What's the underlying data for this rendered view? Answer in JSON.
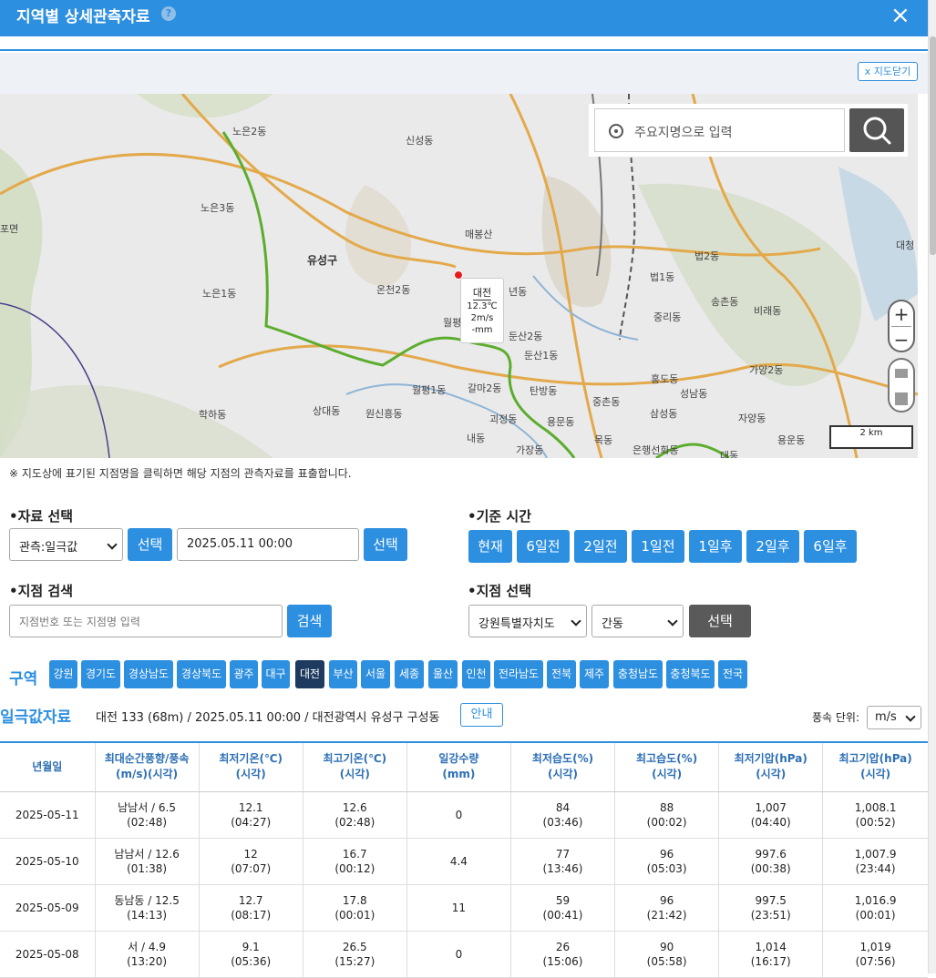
{
  "window": {
    "title": "지역별 상세관측자료",
    "help_icon": "?",
    "close_icon": "×"
  },
  "map": {
    "toggle_label": "x 지도닫기",
    "search_placeholder": "주요지명으로 입력",
    "labels": [
      "노은2동",
      "신성동",
      "노은3동",
      "유성구",
      "매봉산",
      "노은1동",
      "온천2동",
      "년동",
      "월평",
      "둔산2동",
      "둔산1동",
      "월평1동",
      "갈마2동",
      "탄방동",
      "상대동",
      "원신흥동",
      "괴정동",
      "용문동",
      "학하동",
      "내동",
      "가장동",
      "중촌동",
      "삼성동",
      "홍도동",
      "성남동",
      "법2동",
      "법1동",
      "송촌동",
      "비래동",
      "중리동",
      "가양2동",
      "자양동",
      "용운동",
      "목동",
      "은행선화동",
      "대동",
      "대청",
      "포면"
    ],
    "station": {
      "name": "대전",
      "temp": "12.3℃",
      "wind": "2m/s",
      "rain": "-mm"
    },
    "scale_label": "2 km",
    "zoom_in": "+",
    "zoom_out": "−"
  },
  "notice": "※ 지도상에 표기된 지점명을 클릭하면 해당 지점의 관측자료를 표출합니다.",
  "data_select": {
    "label": "•자료 선택",
    "type_value": "관측:일극값",
    "select_btn": "선택",
    "date_value": "2025.05.11 00:00",
    "select_btn2": "선택"
  },
  "base_time": {
    "label": "•기준 시간",
    "buttons": [
      "현재",
      "6일전",
      "2일전",
      "1일전",
      "1일후",
      "2일후",
      "6일후"
    ]
  },
  "station_search": {
    "label": "•지점 검색",
    "placeholder": "지점번호 또는 지점명 입력",
    "search_btn": "검색"
  },
  "station_select": {
    "label": "•지점 선택",
    "province": "강원특별자치도",
    "station": "간동",
    "select_btn": "선택"
  },
  "regions": {
    "label": "구역",
    "items": [
      "강원",
      "경기도",
      "경상남도",
      "경상북도",
      "광주",
      "대구",
      "대전",
      "부산",
      "서울",
      "세종",
      "울산",
      "인천",
      "전라남도",
      "전북",
      "제주",
      "충청남도",
      "충청북도",
      "전국"
    ],
    "active": "대전"
  },
  "result": {
    "title": "일극값자료",
    "info": "대전 133 (68m) / 2025.05.11 00:00 / 대전광역시 유성구 구성동",
    "guide_btn": "안내",
    "wind_unit_label": "풍속 단위:",
    "wind_unit_value": "m/s"
  },
  "table": {
    "headers": [
      [
        "년월일",
        ""
      ],
      [
        "최대순간풍향/풍속",
        "(m/s)(시각)"
      ],
      [
        "최저기온(℃)",
        "(시각)"
      ],
      [
        "최고기온(℃)",
        "(시각)"
      ],
      [
        "일강수량",
        "(mm)"
      ],
      [
        "최저습도(%)",
        "(시각)"
      ],
      [
        "최고습도(%)",
        "(시각)"
      ],
      [
        "최저기압(hPa)",
        "(시각)"
      ],
      [
        "최고기압(hPa)",
        "(시각)"
      ]
    ],
    "rows": [
      [
        [
          "2025-05-11",
          ""
        ],
        [
          "남남서 / 6.5",
          "(02:48)"
        ],
        [
          "12.1",
          "(04:27)"
        ],
        [
          "12.6",
          "(02:48)"
        ],
        [
          "0",
          ""
        ],
        [
          "84",
          "(03:46)"
        ],
        [
          "88",
          "(00:02)"
        ],
        [
          "1,007",
          "(04:40)"
        ],
        [
          "1,008.1",
          "(00:52)"
        ]
      ],
      [
        [
          "2025-05-10",
          ""
        ],
        [
          "남남서 / 12.6",
          "(01:38)"
        ],
        [
          "12",
          "(07:07)"
        ],
        [
          "16.7",
          "(00:12)"
        ],
        [
          "4.4",
          ""
        ],
        [
          "77",
          "(13:46)"
        ],
        [
          "96",
          "(05:03)"
        ],
        [
          "997.6",
          "(00:38)"
        ],
        [
          "1,007.9",
          "(23:44)"
        ]
      ],
      [
        [
          "2025-05-09",
          ""
        ],
        [
          "동남동 / 12.5",
          "(14:13)"
        ],
        [
          "12.7",
          "(08:17)"
        ],
        [
          "17.8",
          "(00:01)"
        ],
        [
          "11",
          ""
        ],
        [
          "59",
          "(00:41)"
        ],
        [
          "96",
          "(21:42)"
        ],
        [
          "997.5",
          "(23:51)"
        ],
        [
          "1,016.9",
          "(00:01)"
        ]
      ],
      [
        [
          "2025-05-08",
          ""
        ],
        [
          "서 / 4.9",
          "(13:20)"
        ],
        [
          "9.1",
          "(05:36)"
        ],
        [
          "26.5",
          "(15:27)"
        ],
        [
          "0",
          ""
        ],
        [
          "26",
          "(15:06)"
        ],
        [
          "90",
          "(05:58)"
        ],
        [
          "1,014",
          "(16:17)"
        ],
        [
          "1,019",
          "(07:56)"
        ]
      ]
    ]
  }
}
